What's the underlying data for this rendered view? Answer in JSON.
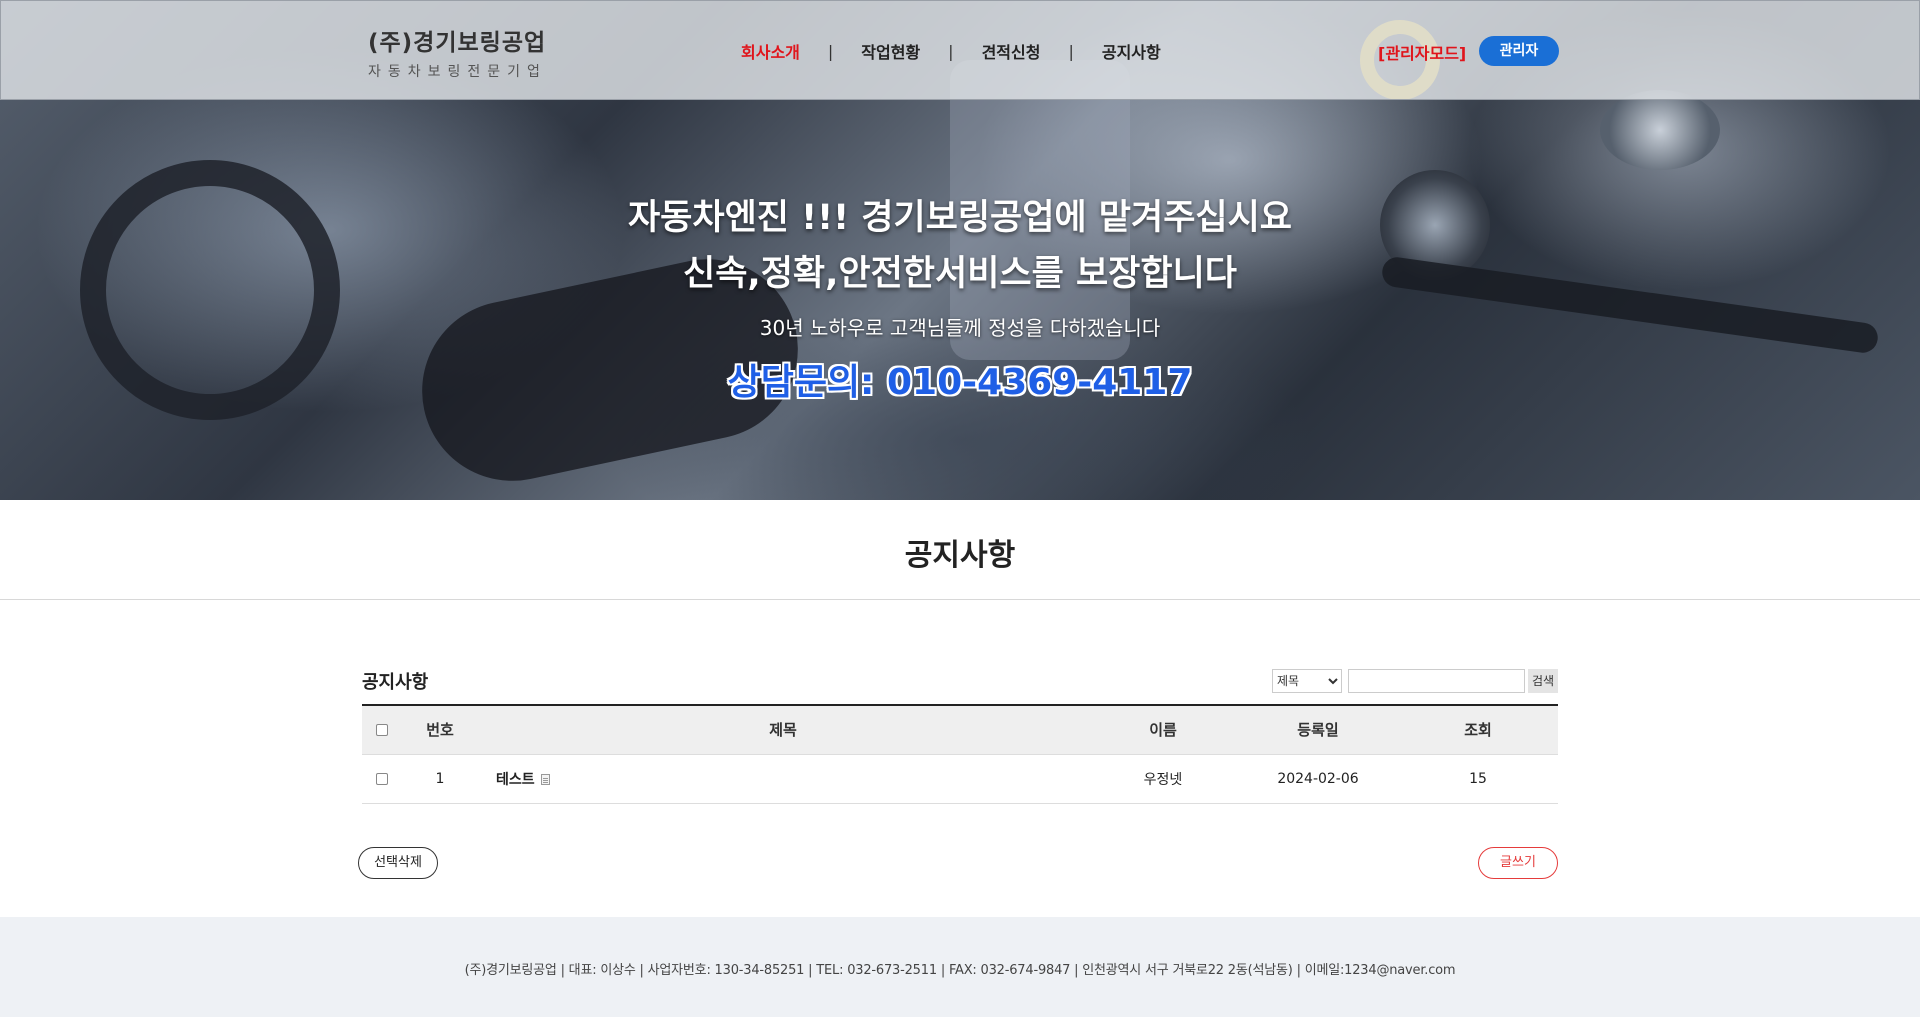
{
  "header": {
    "logo_main": "(주)경기보링공업",
    "logo_sub": "자동차보링전문기업",
    "nav": [
      {
        "label": "회사소개"
      },
      {
        "label": "작업현황"
      },
      {
        "label": "견적신청"
      },
      {
        "label": "공지사항"
      }
    ],
    "nav_separator": "|",
    "admin_mode": "[관리자모드]",
    "admin_button": "관리자",
    "active_color": "#e0141b",
    "button_color": "#1a6fd6"
  },
  "hero": {
    "line1": "자동차엔진 !!! 경기보링공업에 맡겨주십시요",
    "line2": "신속,정확,안전한서비스를 보장합니다",
    "line3": "30년 노하우로 고객님들께 정성을 다하겠습니다",
    "line4": "상담문의: 010-4369-4117"
  },
  "page": {
    "title": "공지사항"
  },
  "board": {
    "title": "공지사항",
    "search": {
      "field_options": [
        "제목"
      ],
      "selected": "제목",
      "query": "",
      "button": "검색"
    },
    "columns": [
      "번호",
      "제목",
      "이름",
      "등록일",
      "조회"
    ],
    "rows": [
      {
        "no": "1",
        "subject": "테스트",
        "name": "우정넷",
        "date": "2024-02-06",
        "views": "15",
        "has_attachment_icon": true
      }
    ],
    "delete_button": "선택삭제",
    "write_button": "글쓰기"
  },
  "footer": {
    "info": "(주)경기보링공업   |  대표: 이상수  |  사업자번호: 130-34-85251  |  TEL: 032-673-2511  |  FAX: 032-674-9847  |  인천광역시 서구 거북로22 2동(석남동)   |  이메일:1234@naver.com"
  }
}
